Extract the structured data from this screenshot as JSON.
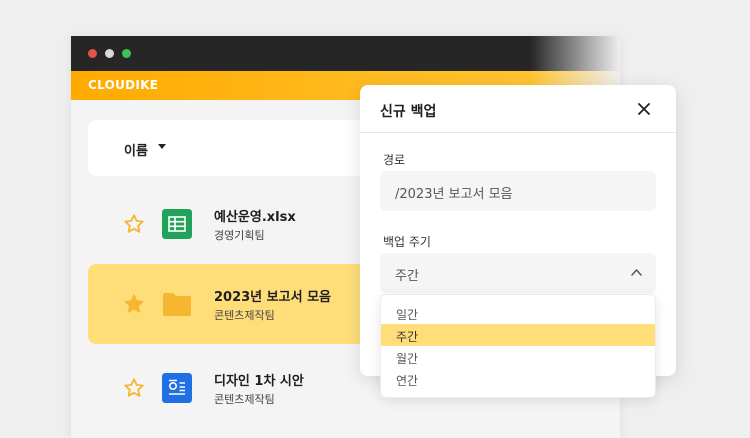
{
  "brand": "CLOUDIKE",
  "sort": {
    "label": "이름"
  },
  "files": [
    {
      "name": "예산운영.xlsx",
      "meta": "경영기획팀",
      "icon": "spreadsheet-icon",
      "starred": false,
      "color": "#21a459"
    },
    {
      "name": "2023년 보고서 모음",
      "meta": "콘텐츠제작팀",
      "icon": "folder-icon",
      "starred": true,
      "color": "#f5b630"
    },
    {
      "name": "디자인 1차 시안",
      "meta": "콘텐츠제작팀",
      "icon": "document-icon",
      "starred": false,
      "color": "#1f6fe5"
    }
  ],
  "dialog": {
    "title": "신규 백업",
    "path_label": "경로",
    "path_value": "/2023년 보고서 모음",
    "cycle_label": "백업 주기",
    "cycle_value": "주간",
    "options": [
      "일간",
      "주간",
      "월간",
      "연간"
    ],
    "selected_option": "주간"
  },
  "colors": {
    "accent": "#ffb000",
    "highlight": "#ffde7a",
    "star": "#f5b630"
  }
}
